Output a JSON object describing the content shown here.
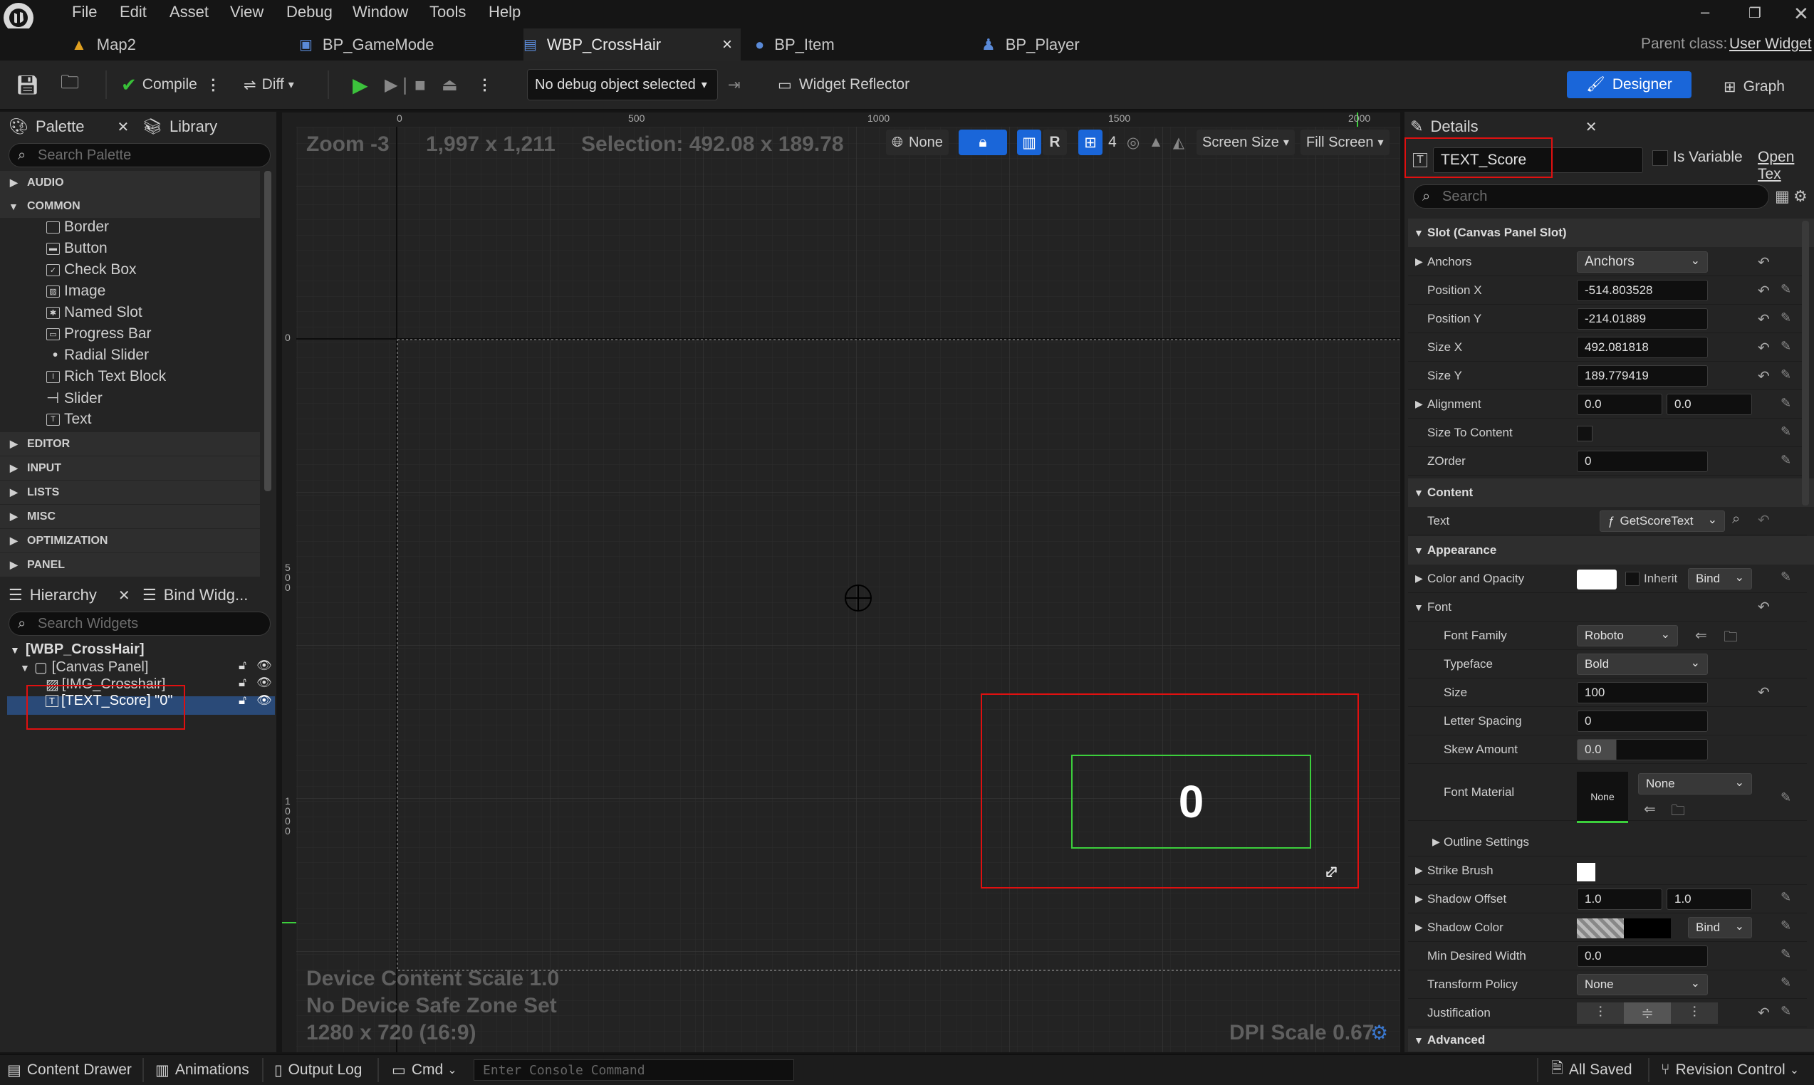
{
  "menu": [
    "File",
    "Edit",
    "Asset",
    "View",
    "Debug",
    "Window",
    "Tools",
    "Help"
  ],
  "tabs": [
    {
      "label": "Map2"
    },
    {
      "label": "BP_GameMode"
    },
    {
      "label": "WBP_CrossHair",
      "close": "×"
    },
    {
      "label": "BP_Item"
    },
    {
      "label": "BP_Player"
    }
  ],
  "parent_class": {
    "label": "Parent class:",
    "value": "User Widget"
  },
  "toolbar": {
    "compile": "Compile",
    "diff": "Diff",
    "debug_object": "No debug object selected",
    "widget_reflector": "Widget Reflector",
    "designer": "Designer",
    "graph": "Graph"
  },
  "palette": {
    "tab": "Palette",
    "library": "Library",
    "search_placeholder": "Search Palette",
    "categories": [
      "AUDIO",
      "COMMON",
      "EDITOR",
      "INPUT",
      "LISTS",
      "MISC",
      "OPTIMIZATION",
      "PANEL"
    ],
    "common_items": [
      "Border",
      "Button",
      "Check Box",
      "Image",
      "Named Slot",
      "Progress Bar",
      "Radial Slider",
      "Rich Text Block",
      "Slider",
      "Text"
    ]
  },
  "hierarchy": {
    "tab": "Hierarchy",
    "bind": "Bind Widg...",
    "search_placeholder": "Search Widgets",
    "items": [
      "[WBP_CrossHair]",
      "[Canvas Panel]",
      "[IMG_Crosshair]",
      "[TEXT_Score] \"0\""
    ]
  },
  "canvas": {
    "zoom": "Zoom -3",
    "resolution": "1,997 x 1,211",
    "selection": "Selection: 492.08 x 189.78",
    "none": "None",
    "r": "R",
    "grid": "4",
    "screen_size": "Screen Size",
    "fill_screen": "Fill Screen",
    "ruler_top": [
      "0",
      "500",
      "1000",
      "1500",
      "2000"
    ],
    "ruler_left": [
      "0",
      "500",
      "1000"
    ],
    "score_text": "0",
    "device_scale": "Device Content Scale 1.0",
    "safe_zone": "No Device Safe Zone Set",
    "res_info": "1280 x 720 (16:9)",
    "dpi": "DPI Scale 0.67"
  },
  "details": {
    "tab": "Details",
    "name": "TEXT_Score",
    "is_variable": "Is Variable",
    "open": "Open Tex",
    "search_placeholder": "Search",
    "slot_section": "Slot (Canvas Panel Slot)",
    "anchors_label": "Anchors",
    "anchors_value": "Anchors",
    "position_x_label": "Position X",
    "position_x": "-514.803528",
    "position_y_label": "Position Y",
    "position_y": "-214.01889",
    "size_x_label": "Size X",
    "size_x": "492.081818",
    "size_y_label": "Size Y",
    "size_y": "189.779419",
    "alignment_label": "Alignment",
    "alignment_x": "0.0",
    "alignment_y": "0.0",
    "size_to_content_label": "Size To Content",
    "zorder_label": "ZOrder",
    "zorder": "0",
    "content_section": "Content",
    "text_label": "Text",
    "text_binding": "GetScoreText",
    "appearance_section": "Appearance",
    "color_label": "Color and Opacity",
    "inherit": "Inherit",
    "bind": "Bind",
    "font_label": "Font",
    "font_family_label": "Font Family",
    "font_family": "Roboto",
    "typeface_label": "Typeface",
    "typeface": "Bold",
    "size_label": "Size",
    "size": "100",
    "letter_spacing_label": "Letter Spacing",
    "letter_spacing": "0",
    "skew_label": "Skew Amount",
    "skew": "0.0",
    "font_material_label": "Font Material",
    "font_material": "None",
    "font_material_swatch": "None",
    "outline_label": "Outline Settings",
    "strike_label": "Strike Brush",
    "shadow_offset_label": "Shadow Offset",
    "shadow_offset_x": "1.0",
    "shadow_offset_y": "1.0",
    "shadow_color_label": "Shadow Color",
    "min_width_label": "Min Desired Width",
    "min_width": "0.0",
    "transform_label": "Transform Policy",
    "transform": "None",
    "justification_label": "Justification",
    "advanced_section": "Advanced"
  },
  "statusbar": {
    "content_drawer": "Content Drawer",
    "animations": "Animations",
    "output_log": "Output Log",
    "cmd": "Cmd",
    "console_placeholder": "Enter Console Command",
    "all_saved": "All Saved",
    "revision": "Revision Control"
  },
  "colors": {
    "accent": "#1a66d9",
    "selection_red": "#e01010",
    "text_bounds_green": "#3ccf3c",
    "panel": "#242424"
  }
}
